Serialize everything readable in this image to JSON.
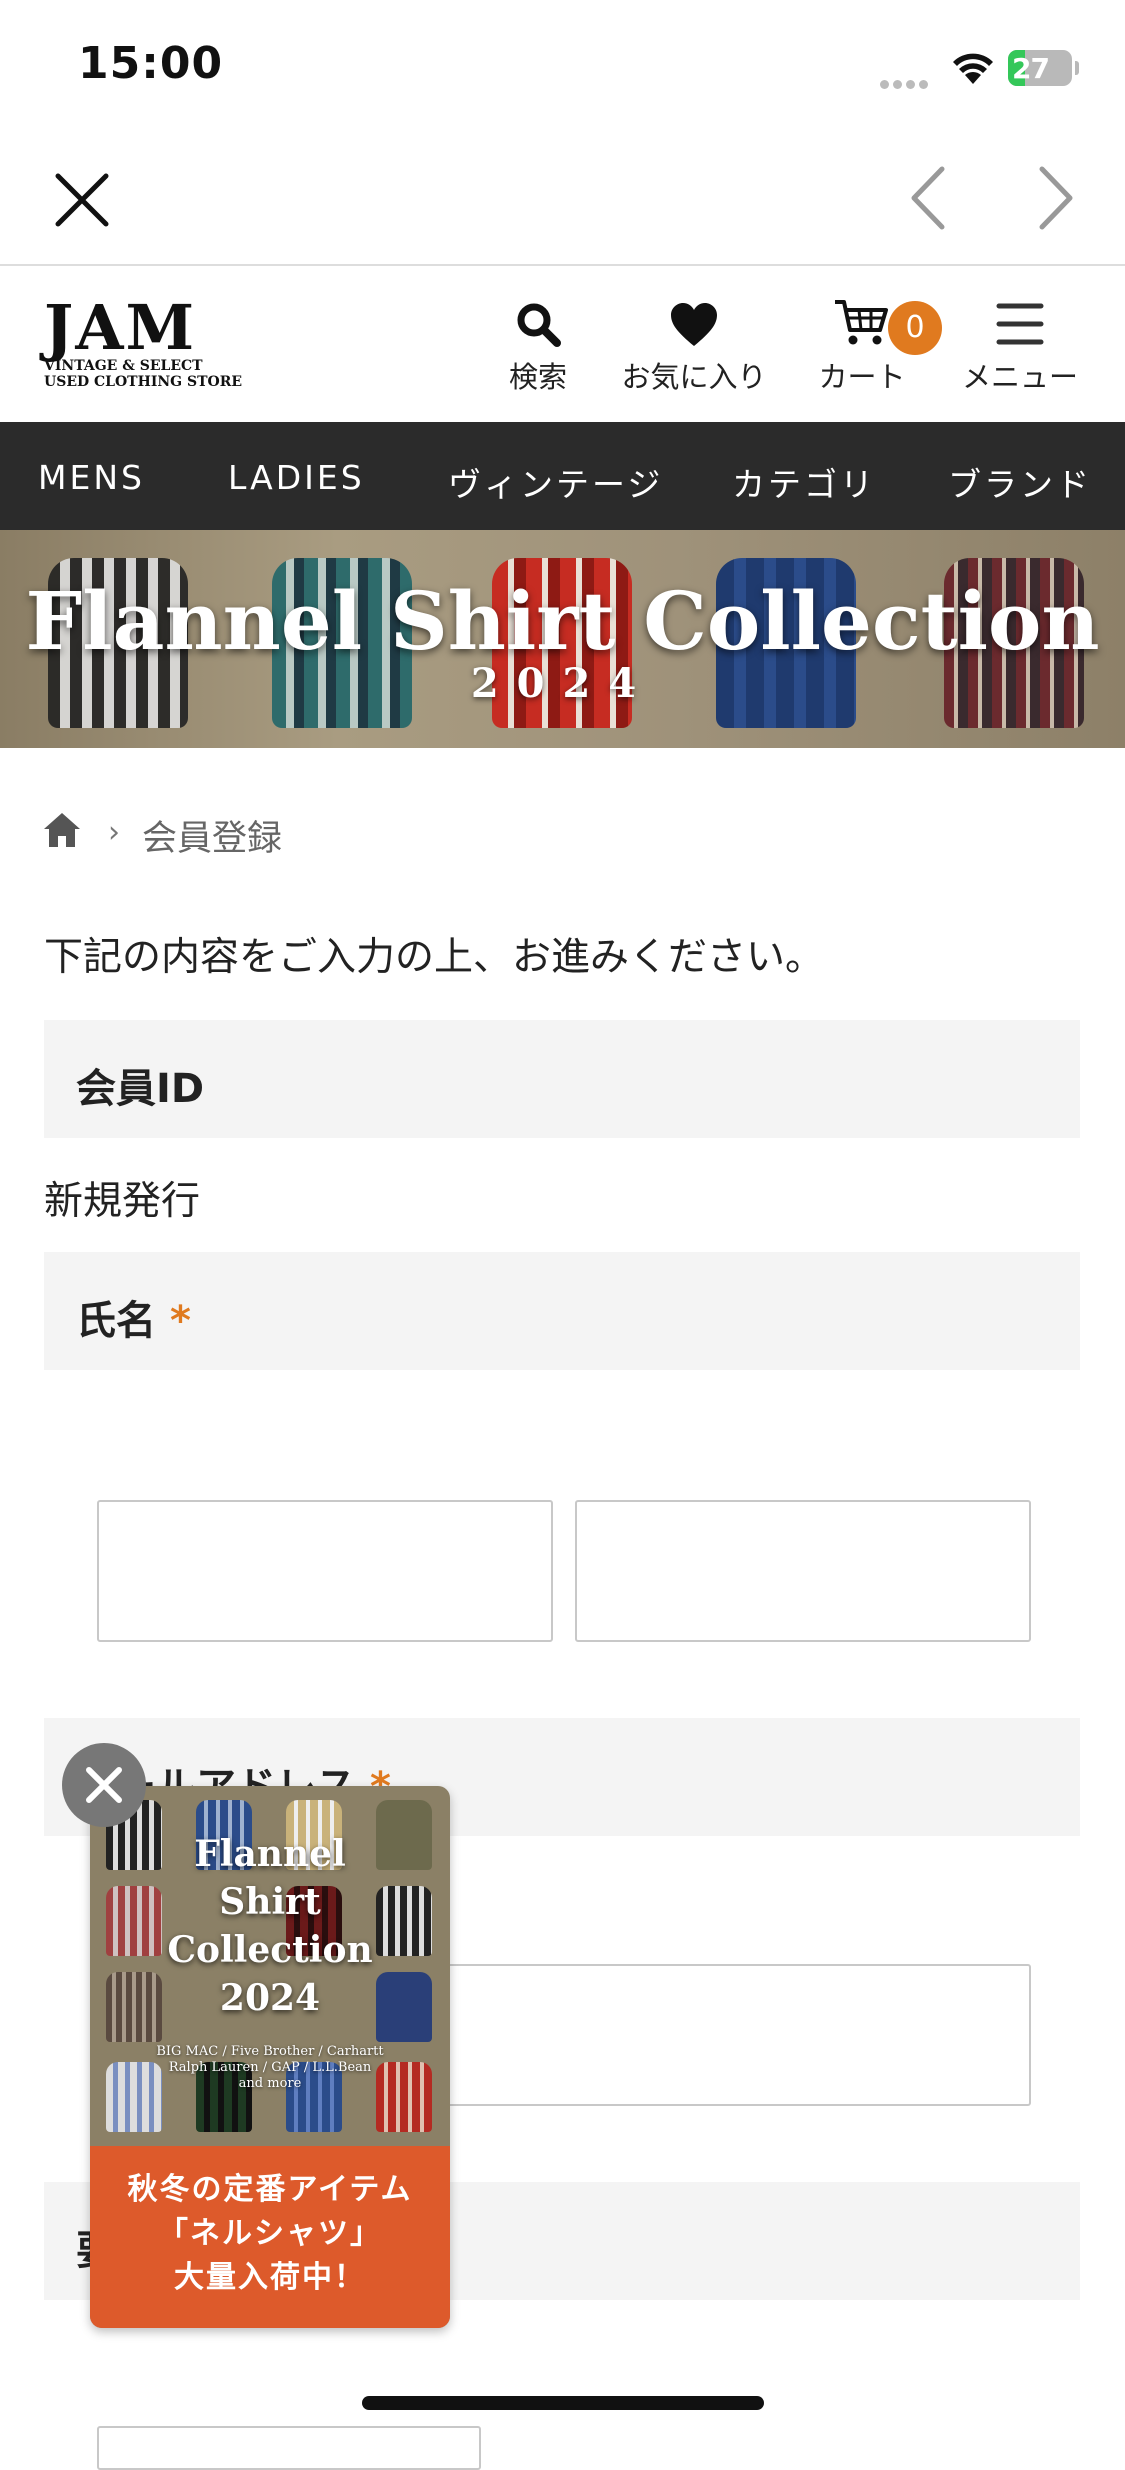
{
  "status_bar": {
    "time": "15:00",
    "battery": "27",
    "battery_level": 0.27
  },
  "header": {
    "logo_main": "JAM",
    "logo_sub_1": "VINTAGE & SELECT",
    "logo_sub_2": "USED CLOTHING STORE",
    "search_label": "検索",
    "favorites_label": "お気に入り",
    "cart_label": "カート",
    "cart_count": "0",
    "menu_label": "メニュー"
  },
  "categories": [
    "MENS",
    "LADIES",
    "ヴィンテージ",
    "カテゴリ",
    "ブランド"
  ],
  "banner": {
    "title": "Flannel Shirt Collection",
    "year": "2024"
  },
  "breadcrumb": {
    "current": "会員登録"
  },
  "form": {
    "intro": "下記の内容をご入力の上、お進みください。",
    "member_id_label": "会員ID",
    "member_id_value": "新規発行",
    "name_label": "氏名",
    "email_label": "メールアドレス",
    "required_mark": "*",
    "next_section_label": "要"
  },
  "popup": {
    "title_1": "Flannel",
    "title_2": "Shirt",
    "title_3": "Collection",
    "title_4": "2024",
    "brands_1": "BIG MAC / Five Brother / Carhartt",
    "brands_2": "Ralph Lauren / GAP / L.L.Bean",
    "brands_3": "and more",
    "footer_1": "秋冬の定番アイテム",
    "footer_2": "「ネルシャツ」",
    "footer_3": "大量入荷中！"
  },
  "colors": {
    "accent_orange": "#e07a1f",
    "popup_orange": "#dd5a2b",
    "category_bar": "#2b2b2b",
    "battery_green": "#34c759"
  }
}
